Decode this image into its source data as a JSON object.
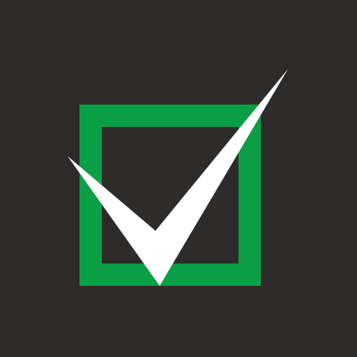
{
  "icon": {
    "name": "checkbox-checked-icon",
    "state": "checked"
  },
  "colors": {
    "background": "#2e2c2b",
    "box_border": "#0a9e46",
    "checkmark": "#ffffff"
  }
}
